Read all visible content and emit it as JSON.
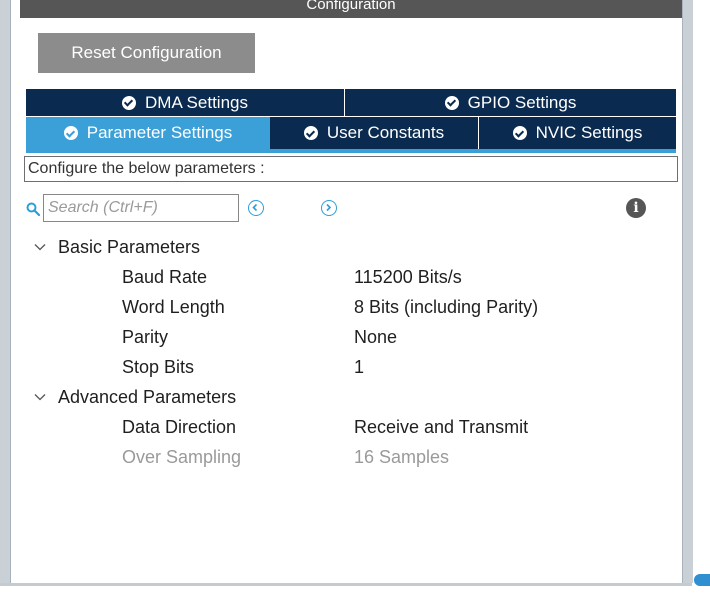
{
  "window": {
    "title": "Configuration"
  },
  "toolbar": {
    "reset_label": "Reset Configuration"
  },
  "tabs_top": [
    {
      "label": "DMA Settings",
      "icon": "check-circle-icon"
    },
    {
      "label": "GPIO Settings",
      "icon": "check-circle-icon"
    }
  ],
  "tabs_bottom": [
    {
      "label": "Parameter Settings",
      "icon": "check-circle-icon",
      "active": true
    },
    {
      "label": "User Constants",
      "icon": "check-circle-icon",
      "active": false
    },
    {
      "label": "NVIC Settings",
      "icon": "check-circle-icon",
      "active": false
    }
  ],
  "params_description": "Configure the below parameters :",
  "search": {
    "placeholder": "Search (Ctrl+F)"
  },
  "groups": [
    {
      "label": "Basic Parameters",
      "params": [
        {
          "name": "Baud Rate",
          "value": "115200 Bits/s"
        },
        {
          "name": "Word Length",
          "value": "8 Bits (including Parity)"
        },
        {
          "name": "Parity",
          "value": "None"
        },
        {
          "name": "Stop Bits",
          "value": "1"
        }
      ]
    },
    {
      "label": "Advanced Parameters",
      "params": [
        {
          "name": "Data Direction",
          "value": "Receive and Transmit"
        },
        {
          "name": "Over Sampling",
          "value": "16 Samples",
          "disabled": true
        }
      ]
    }
  ],
  "colors": {
    "header_bg": "#565656",
    "tab_bg": "#0b2a4f",
    "tab_active_bg": "#3ca0d8",
    "accent": "#2f9ed8",
    "disabled_text": "#9a9a9a"
  }
}
